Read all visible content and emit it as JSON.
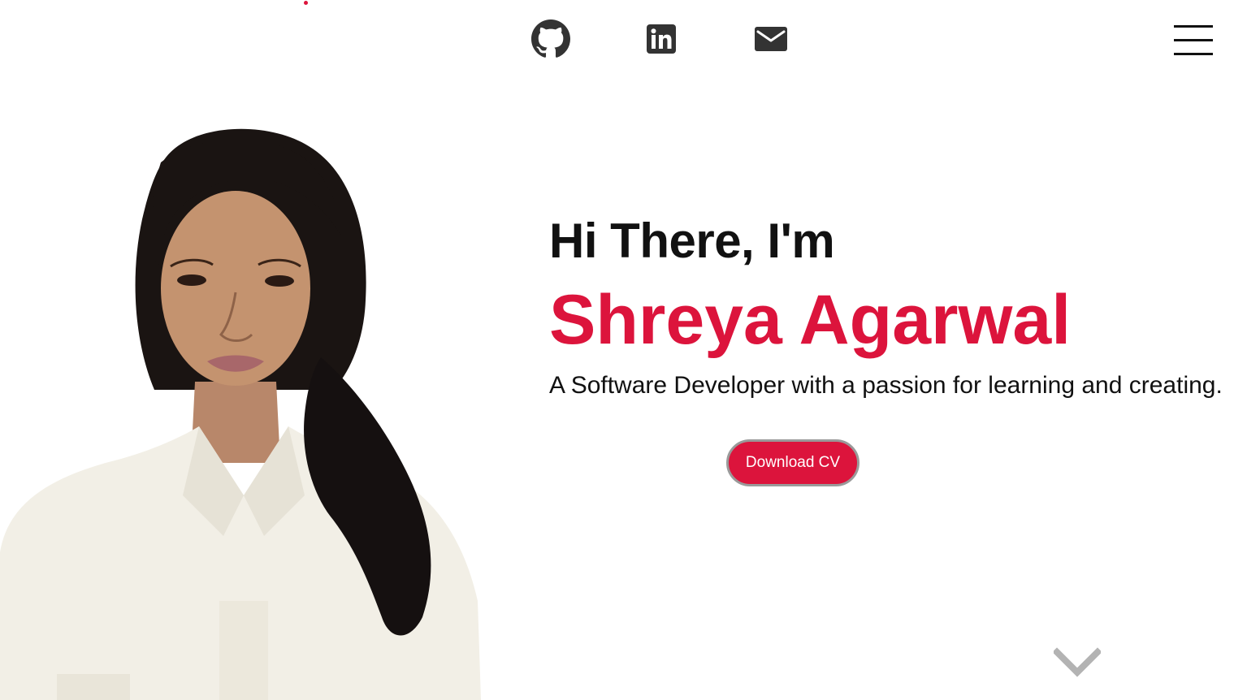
{
  "social": {
    "github_icon": "github-icon",
    "linkedin_icon": "linkedin-icon",
    "email_icon": "email-icon"
  },
  "menu_icon": "hamburger-menu-icon",
  "hero": {
    "greeting": "Hi There, I'm",
    "name": "Shreya Agarwal",
    "tagline": "A Software Developer with a passion for learning and creating.",
    "download_label": "Download CV"
  },
  "scroll_icon": "chevron-down-icon",
  "colors": {
    "accent": "#dc143c",
    "text": "#111111",
    "icon": "#333333",
    "chevron": "#b3b3b3"
  }
}
